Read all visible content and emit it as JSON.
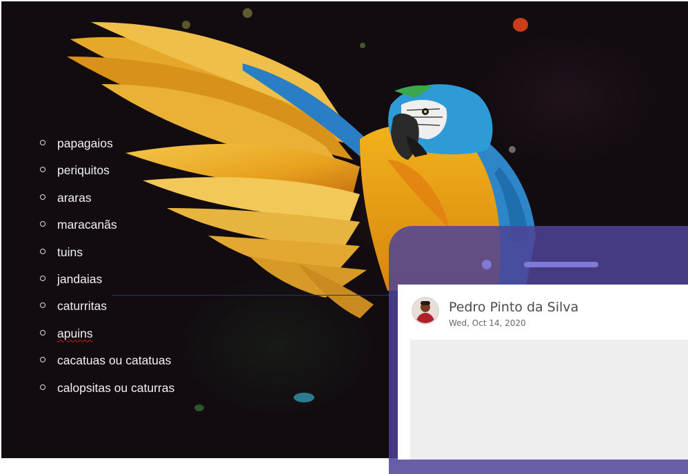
{
  "species_list": {
    "items": [
      {
        "label": "papagaios"
      },
      {
        "label": "periquitos"
      },
      {
        "label": "araras"
      },
      {
        "label": "maracanãs"
      },
      {
        "label": "tuins"
      },
      {
        "label": "jandaias"
      },
      {
        "label": "caturritas"
      },
      {
        "label": "apuins"
      },
      {
        "label": "cacatuas ou catatuas"
      },
      {
        "label": "calopsitas ou caturras"
      }
    ]
  },
  "post": {
    "author": "Pedro Pinto da Silva",
    "date": "Wed, Oct 14, 2020"
  },
  "colors": {
    "device_frame": "#4e4496",
    "background": "#120b10",
    "list_text": "#f2f2f2"
  },
  "icons": {
    "avatar": "user-avatar",
    "bullet": "hollow-circle-bullet"
  }
}
